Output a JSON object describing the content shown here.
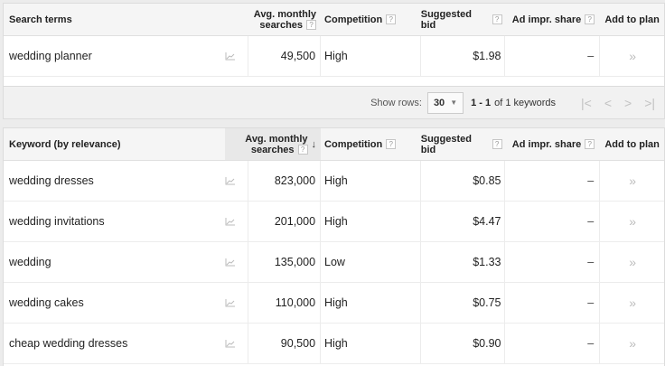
{
  "search_table": {
    "headers": {
      "keyword": "Search terms",
      "avg_line1": "Avg. monthly",
      "avg_line2": "searches",
      "competition": "Competition",
      "bid": "Suggested bid",
      "share": "Ad impr. share",
      "add": "Add to plan"
    },
    "rows": [
      {
        "keyword": "wedding planner",
        "avg": "49,500",
        "competition": "High",
        "bid": "$1.98",
        "share": "–"
      }
    ]
  },
  "pager": {
    "show_rows_label": "Show rows:",
    "rows_value": "30",
    "range": "1 - 1",
    "range_tail": "of 1 keywords"
  },
  "keyword_table": {
    "headers": {
      "keyword": "Keyword (by relevance)",
      "avg_line1": "Avg. monthly",
      "avg_line2": "searches",
      "competition": "Competition",
      "bid": "Suggested bid",
      "share": "Ad impr. share",
      "add": "Add to plan"
    },
    "rows": [
      {
        "keyword": "wedding dresses",
        "avg": "823,000",
        "competition": "High",
        "bid": "$0.85",
        "share": "–"
      },
      {
        "keyword": "wedding invitations",
        "avg": "201,000",
        "competition": "High",
        "bid": "$4.47",
        "share": "–"
      },
      {
        "keyword": "wedding",
        "avg": "135,000",
        "competition": "Low",
        "bid": "$1.33",
        "share": "–"
      },
      {
        "keyword": "wedding cakes",
        "avg": "110,000",
        "competition": "High",
        "bid": "$0.75",
        "share": "–"
      },
      {
        "keyword": "cheap wedding dresses",
        "avg": "90,500",
        "competition": "High",
        "bid": "$0.90",
        "share": "–"
      }
    ]
  },
  "icons": {
    "help": "?",
    "add": "»",
    "sort": "↓",
    "first": "|<",
    "prev": "<",
    "next": ">",
    "last": ">|",
    "caret": "▼"
  }
}
